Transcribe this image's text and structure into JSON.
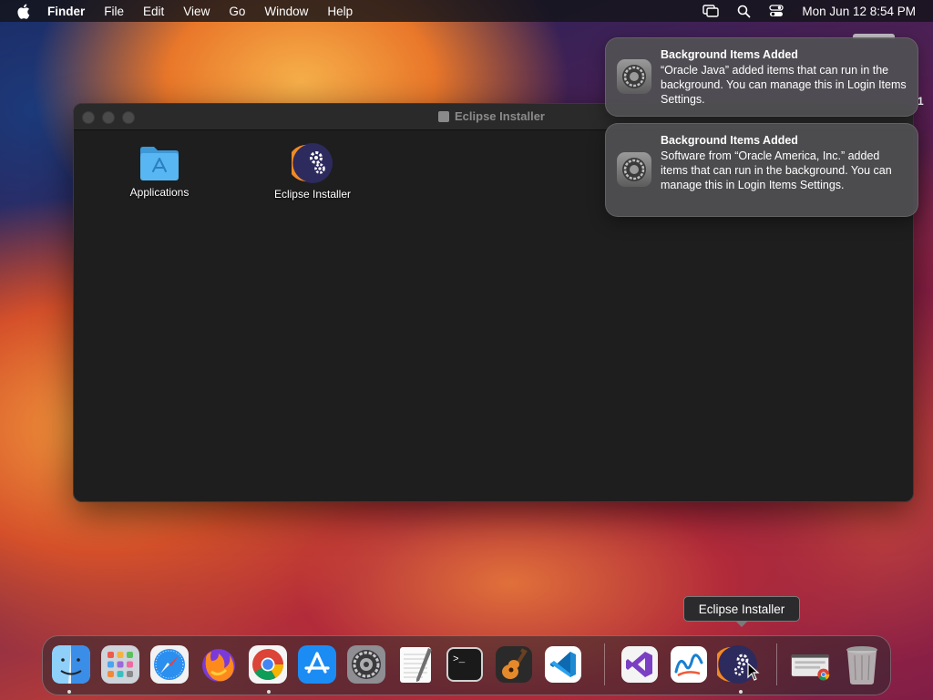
{
  "menubar": {
    "app": "Finder",
    "items": [
      "File",
      "Edit",
      "View",
      "Go",
      "Window",
      "Help"
    ],
    "clock": "Mon Jun 12  8:54 PM",
    "status_icons": [
      "screen-mirroring-icon",
      "search-icon",
      "control-center-icon"
    ]
  },
  "window": {
    "title": "Eclipse Installer",
    "items": [
      {
        "label": "Applications",
        "icon": "applications-folder-icon"
      },
      {
        "label": "Eclipse Installer",
        "icon": "eclipse-installer-icon"
      }
    ]
  },
  "notifications": [
    {
      "title": "Background Items Added",
      "body": "“Oracle Java” added items that can run in the background. You can manage this in Login Items Settings."
    },
    {
      "title": "Background Items Added",
      "body": "Software from “Oracle America, Inc.” added items that can run in the background. You can manage this in Login Items Settings."
    }
  ],
  "stray_text": "1",
  "tooltip": "Eclipse Installer",
  "dock": {
    "apps": [
      "Finder",
      "Launchpad",
      "Safari",
      "Firefox",
      "Google Chrome",
      "App Store",
      "System Settings",
      "TextEdit",
      "Terminal",
      "GarageBand",
      "Visual Studio Code",
      "Visual Studio",
      "Freeform",
      "Eclipse Installer",
      "Downloads",
      "Trash"
    ]
  },
  "colors": {
    "menubar": "#141418",
    "window_bg": "#1e1e1e",
    "folder_blue": "#4fb0f0",
    "eclipse_orange": "#f08a24"
  }
}
